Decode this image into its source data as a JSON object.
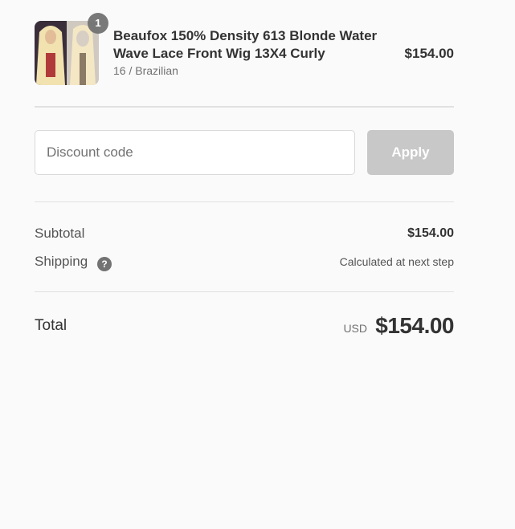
{
  "product": {
    "quantity": "1",
    "title": "Beaufox 150% Density 613 Blonde Water Wave Lace Front Wig 13X4 Curly",
    "variant": "16 / Brazilian",
    "price": "$154.00"
  },
  "discount": {
    "placeholder": "Discount code",
    "apply_label": "Apply"
  },
  "totals": {
    "subtotal_label": "Subtotal",
    "subtotal_value": "$154.00",
    "shipping_label": "Shipping",
    "shipping_value": "Calculated at next step",
    "help_icon": "question-circle-icon",
    "total_label": "Total",
    "currency": "USD",
    "total_value": "$154.00"
  },
  "colors": {
    "background": "#fafafa",
    "apply_button_disabled": "#c8c8c8",
    "badge": "#727272",
    "text": "#333333",
    "muted_text": "#717171"
  }
}
